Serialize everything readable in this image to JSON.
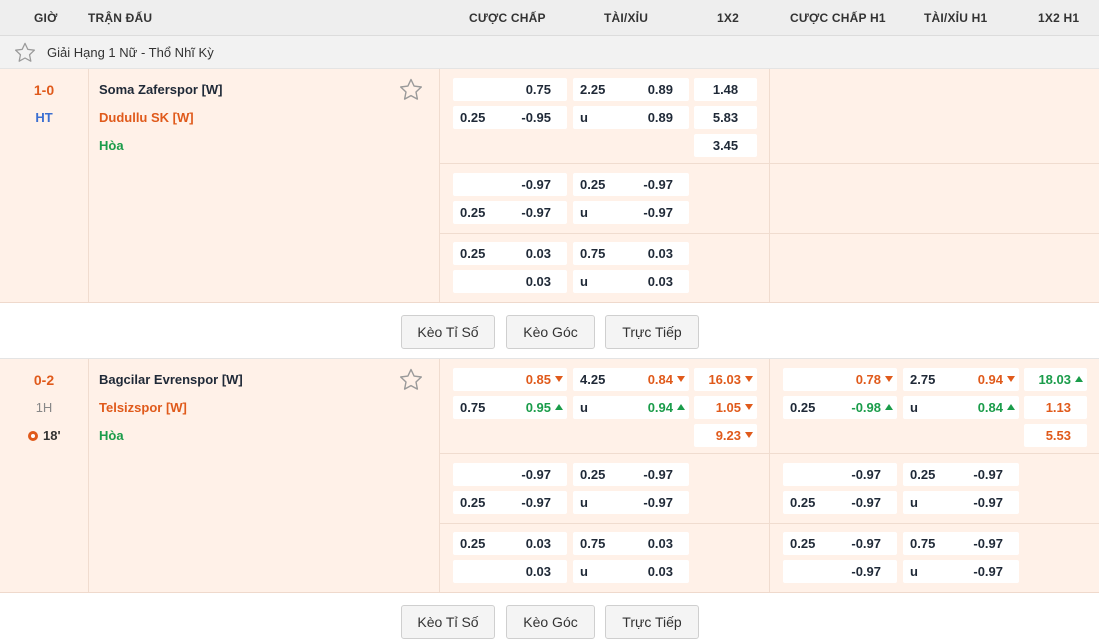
{
  "header": {
    "time": "GIỜ",
    "match": "TRẬN ĐẤU",
    "handicap": "CƯỢC CHẤP",
    "overunder": "TÀI/XỈU",
    "onextwo": "1X2",
    "handicap_h1": "CƯỢC CHẤP H1",
    "overunder_h1": "TÀI/XỈU H1",
    "onextwo_h1": "1X2 H1"
  },
  "league": {
    "name": "Giải Hạng 1 Nữ - Thổ Nhĩ Kỳ"
  },
  "matches": [
    {
      "score": "1-0",
      "status": "HT",
      "home": "Soma Zaferspor [W]",
      "away": "Dudullu SK [W]",
      "draw": "Hòa",
      "rows": [
        {
          "hc": [
            [
              "",
              "0.75"
            ],
            [
              "0.25",
              "-0.95"
            ]
          ],
          "ou": [
            [
              "2.25",
              "0.89"
            ],
            [
              "u",
              "0.89"
            ]
          ],
          "x12": [
            "1.48",
            "5.83",
            "3.45"
          ]
        },
        {
          "hc": [
            [
              "",
              "-0.97"
            ],
            [
              "0.25",
              "-0.97"
            ]
          ],
          "ou": [
            [
              "0.25",
              "-0.97"
            ],
            [
              "u",
              "-0.97"
            ]
          ]
        },
        {
          "hc": [
            [
              "0.25",
              "0.03"
            ],
            [
              "",
              "0.03"
            ]
          ],
          "ou": [
            [
              "0.75",
              "0.03"
            ],
            [
              "u",
              "0.03"
            ]
          ]
        }
      ]
    },
    {
      "score": "0-2",
      "status": "1H",
      "minute": "18'",
      "home": "Bagcilar Evrenspor [W]",
      "away": "Telsizspor [W]",
      "draw": "Hòa",
      "rows": [
        {
          "hc": [
            [
              "",
              "0.85"
            ],
            [
              "0.75",
              "0.95"
            ]
          ],
          "ou": [
            [
              "4.25",
              "0.84"
            ],
            [
              "u",
              "0.94"
            ]
          ],
          "x12": [
            "16.03",
            "1.05",
            "9.23"
          ],
          "hc1": [
            [
              "",
              "0.78"
            ],
            [
              "0.25",
              "-0.98"
            ]
          ],
          "ou1": [
            [
              "2.75",
              "0.94"
            ],
            [
              "u",
              "0.84"
            ]
          ],
          "x121": [
            "18.03",
            "1.13",
            "5.53"
          ]
        },
        {
          "hc": [
            [
              "",
              "-0.97"
            ],
            [
              "0.25",
              "-0.97"
            ]
          ],
          "ou": [
            [
              "0.25",
              "-0.97"
            ],
            [
              "u",
              "-0.97"
            ]
          ],
          "hc1": [
            [
              "",
              "-0.97"
            ],
            [
              "0.25",
              "-0.97"
            ]
          ],
          "ou1": [
            [
              "0.25",
              "-0.97"
            ],
            [
              "u",
              "-0.97"
            ]
          ]
        },
        {
          "hc": [
            [
              "0.25",
              "0.03"
            ],
            [
              "",
              "0.03"
            ]
          ],
          "ou": [
            [
              "0.75",
              "0.03"
            ],
            [
              "u",
              "0.03"
            ]
          ],
          "hc1": [
            [
              "0.25",
              "-0.97"
            ],
            [
              "",
              "-0.97"
            ]
          ],
          "ou1": [
            [
              "0.75",
              "-0.97"
            ],
            [
              "u",
              "-0.97"
            ]
          ]
        }
      ]
    }
  ],
  "actions": {
    "correct_score": "Kèo Tỉ Số",
    "corners": "Kèo Góc",
    "live": "Trực Tiếp"
  },
  "colors": {
    "accent": "#e05a1b",
    "up": "#1a9c4a",
    "status_ht": "#3b6fd1",
    "row_bg": "#fff1e8"
  }
}
